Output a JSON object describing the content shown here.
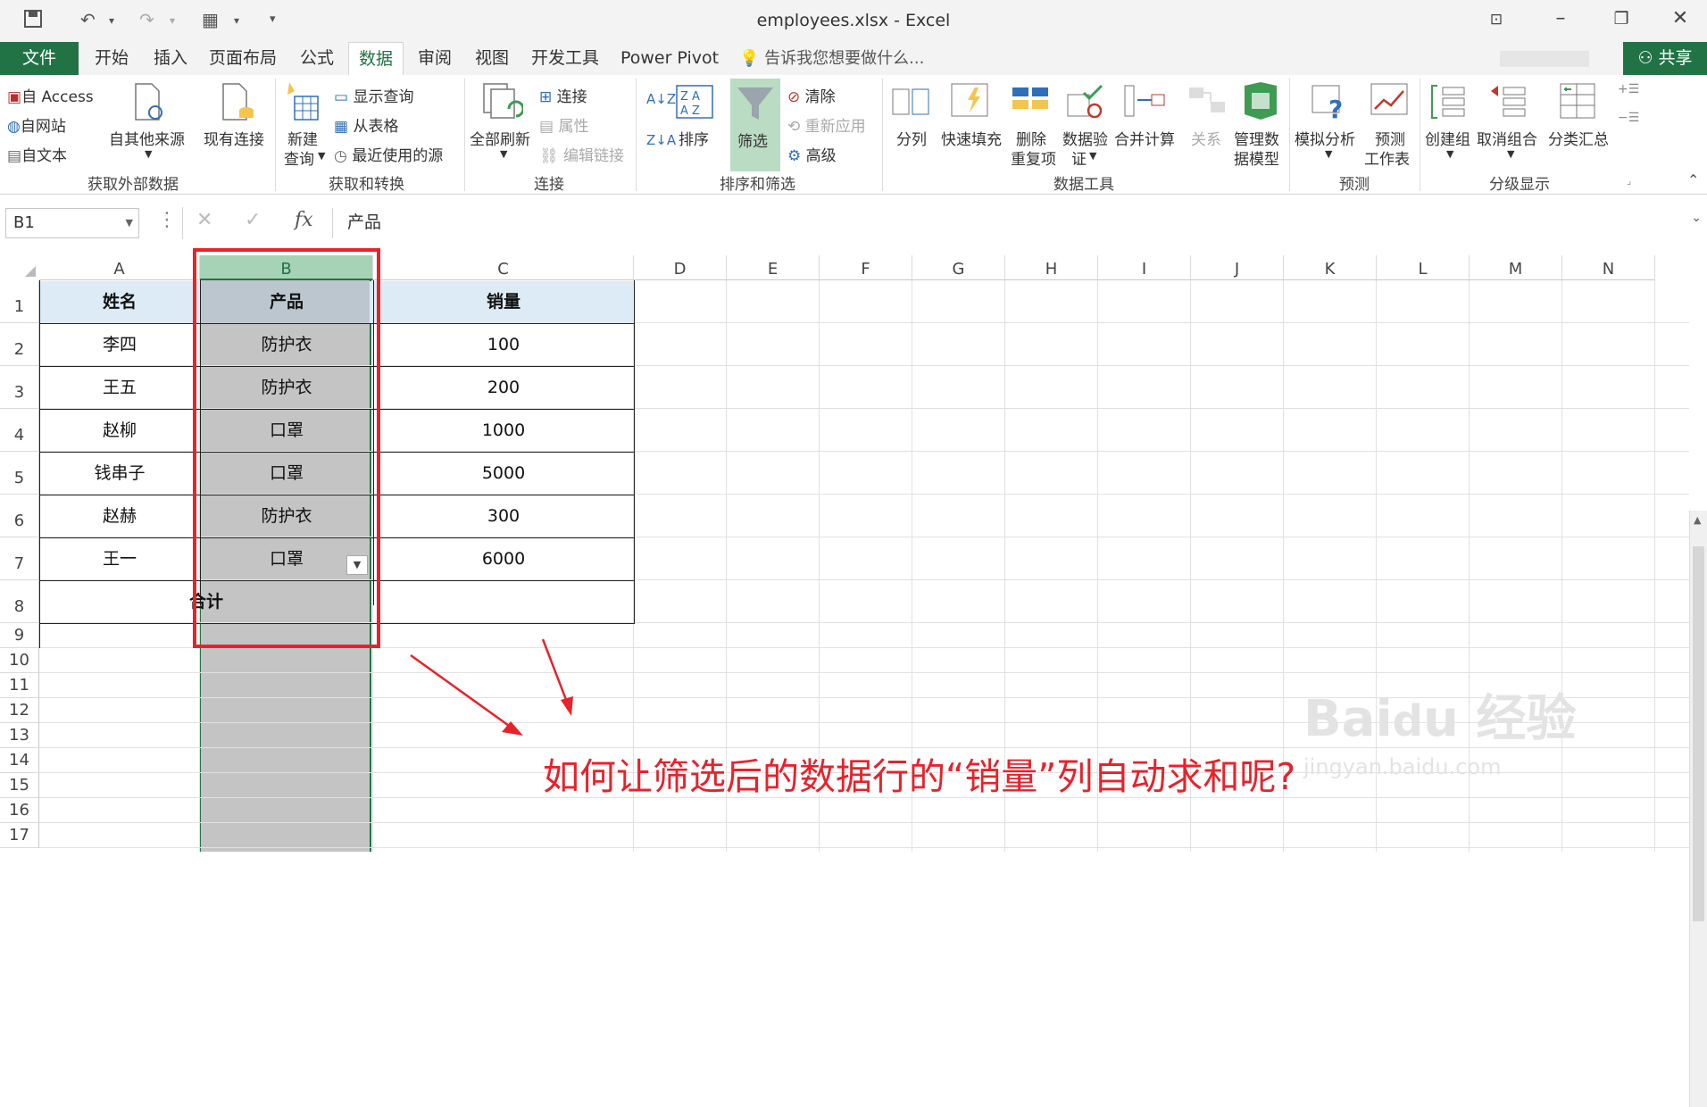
{
  "window": {
    "title": "employees.xlsx - Excel"
  },
  "tabs": {
    "file": "文件",
    "home": "开始",
    "insert": "插入",
    "layout": "页面布局",
    "formulas": "公式",
    "data": "数据",
    "review": "审阅",
    "view": "视图",
    "developer": "开发工具",
    "powerpivot": "Power Pivot",
    "tellme": "告诉我您想要做什么...",
    "share": "共享"
  },
  "ribbon": {
    "from_access": "自 Access",
    "from_web": "自网站",
    "from_text": "自文本",
    "from_other": "自其他来源",
    "existing": "现有连接",
    "group_external": "获取外部数据",
    "new_query_1": "新建",
    "new_query_2": "查询",
    "show_queries": "显示查询",
    "from_table": "从表格",
    "recent_sources": "最近使用的源",
    "group_transform": "获取和转换",
    "refresh_all": "全部刷新",
    "connections": "连接",
    "properties": "属性",
    "edit_links": "编辑链接",
    "group_connections": "连接",
    "sort": "排序",
    "filter": "筛选",
    "clear": "清除",
    "reapply": "重新应用",
    "advanced": "高级",
    "group_sortfilter": "排序和筛选",
    "text_to_cols": "分列",
    "flash_fill": "快速填充",
    "remove_dup_1": "删除",
    "remove_dup_2": "重复项",
    "validation_1": "数据验",
    "validation_2": "证",
    "consolidate": "合并计算",
    "relationships": "关系",
    "data_model_1": "管理数",
    "data_model_2": "据模型",
    "group_datatools": "数据工具",
    "whatif": "模拟分析",
    "forecast_1": "预测",
    "forecast_2": "工作表",
    "group_forecast": "预测",
    "group_ungroup": "创建组",
    "ungroup": "取消组合",
    "subtotal": "分类汇总",
    "group_outline": "分级显示"
  },
  "formula_bar": {
    "name_box": "B1",
    "fx": "fx",
    "content": "产品"
  },
  "columns": [
    "A",
    "B",
    "C",
    "D",
    "E",
    "F",
    "G",
    "H",
    "I",
    "J",
    "K",
    "L",
    "M",
    "N"
  ],
  "rows": [
    "1",
    "2",
    "3",
    "4",
    "5",
    "6",
    "7",
    "8",
    "9",
    "10",
    "11",
    "12",
    "13",
    "14",
    "15",
    "16",
    "17"
  ],
  "table": {
    "headers": [
      "姓名",
      "产品",
      "销量"
    ],
    "rows": [
      [
        "李四",
        "防护衣",
        "100"
      ],
      [
        "王五",
        "防护衣",
        "200"
      ],
      [
        "赵柳",
        "口罩",
        "1000"
      ],
      [
        "钱串子",
        "口罩",
        "5000"
      ],
      [
        "赵赫",
        "防护衣",
        "300"
      ],
      [
        "王一",
        "口罩",
        "6000"
      ]
    ],
    "total_label": "合计"
  },
  "annotation": "如何让筛选后的数据行的“销量”列自动求和呢?",
  "colors": {
    "accent": "#217346",
    "highlight": "#e8222a",
    "header_fill": "#ddebf7",
    "selected_fill": "#c4c4c4"
  }
}
